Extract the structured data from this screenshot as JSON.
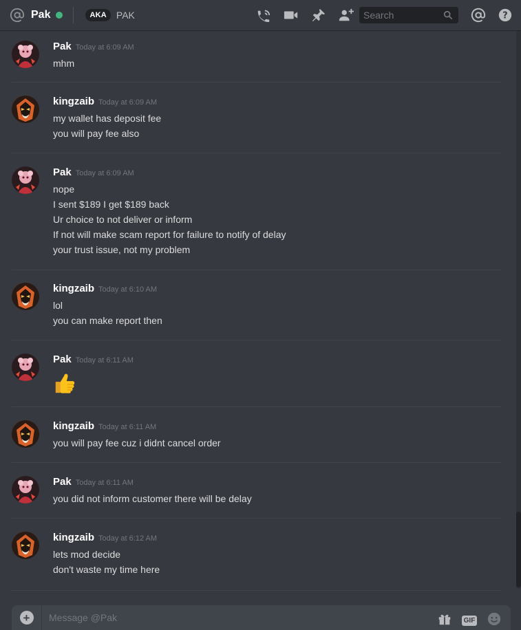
{
  "header": {
    "recipient": "Pak",
    "status_color": "#43b581",
    "aka_label": "AKA",
    "aka_name": "PAK",
    "search_placeholder": "Search",
    "icons": [
      "at-icon",
      "call-icon",
      "video-icon",
      "pin-icon",
      "add-friend-icon",
      "search-icon",
      "mentions-icon",
      "help-icon"
    ]
  },
  "messages": [
    {
      "username": "Pak",
      "timestamp": "Today at 6:09 AM",
      "avatar": "pak-avatar",
      "lines": [
        "mhm"
      ]
    },
    {
      "username": "kingzaib",
      "timestamp": "Today at 6:09 AM",
      "avatar": "kingzaib-avatar",
      "lines": [
        "my wallet has deposit fee",
        "you will pay fee also"
      ]
    },
    {
      "username": "Pak",
      "timestamp": "Today at 6:09 AM",
      "avatar": "pak-avatar",
      "lines": [
        "nope",
        "I sent $189 I get $189 back",
        "Ur choice to not deliver or inform",
        "If not will make scam report for failure to notify of delay",
        "your trust issue, not my problem"
      ]
    },
    {
      "username": "kingzaib",
      "timestamp": "Today at 6:10 AM",
      "avatar": "kingzaib-avatar",
      "lines": [
        "lol",
        "you can make report then"
      ]
    },
    {
      "username": "Pak",
      "timestamp": "Today at 6:11 AM",
      "avatar": "pak-avatar",
      "emoji": "thumbs-up-emoji"
    },
    {
      "username": "kingzaib",
      "timestamp": "Today at 6:11 AM",
      "avatar": "kingzaib-avatar",
      "lines": [
        "you will pay fee cuz i didnt cancel order"
      ]
    },
    {
      "username": "Pak",
      "timestamp": "Today at 6:11 AM",
      "avatar": "pak-avatar",
      "lines": [
        "you did not inform customer there will be delay"
      ]
    },
    {
      "username": "kingzaib",
      "timestamp": "Today at 6:12 AM",
      "avatar": "kingzaib-avatar",
      "lines": [
        "lets mod decide",
        "don't waste my time here"
      ]
    }
  ],
  "composer": {
    "placeholder": "Message @Pak",
    "gif_label": "GIF",
    "icons": [
      "add-attachment-icon",
      "gift-icon",
      "gif-icon",
      "emoji-picker-icon"
    ]
  },
  "colors": {
    "background": "#36393f",
    "username": "#ffffff",
    "timestamp": "#72767d",
    "message_text": "#dcddde"
  }
}
